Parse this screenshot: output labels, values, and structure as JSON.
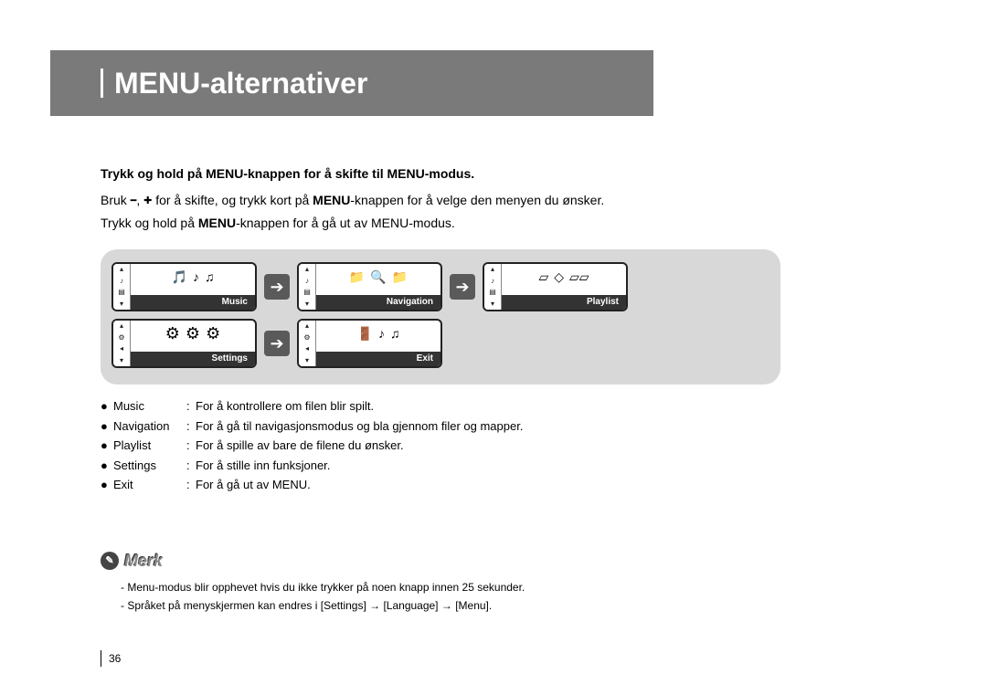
{
  "header": {
    "title": "MENU-alternativer"
  },
  "instructions": {
    "line1": "Trykk og hold på  MENU-knappen for å skifte til MENU-modus.",
    "line2_pre": "Bruk ",
    "line2_post": " for å skifte, og trykk kort på ",
    "line2_b": "MENU",
    "line2_end": "-knappen for å velge den menyen du ønsker.",
    "line3_pre": "Trykk og hold på ",
    "line3_b": "MENU",
    "line3_post": "-knappen for å gå ut av MENU-modus."
  },
  "screens": {
    "music": "Music",
    "navigation": "Navigation",
    "playlist": "Playlist",
    "settings": "Settings",
    "exit": "Exit"
  },
  "descriptions": [
    {
      "term": "Music",
      "text": "For å kontrollere om filen blir spilt."
    },
    {
      "term": "Navigation",
      "text": "For å gå til navigasjonsmodus og bla gjennom filer og mapper."
    },
    {
      "term": "Playlist",
      "text": "For å spille av bare de filene du ønsker."
    },
    {
      "term": "Settings",
      "text": "For å stille inn funksjoner."
    },
    {
      "term": "Exit",
      "text": "For å gå ut av MENU."
    }
  ],
  "merk": {
    "heading": "Merk",
    "note1": "- Menu-modus blir opphevet hvis du ikke trykker på noen knapp innen 25 sekunder.",
    "note2": "- Språket på menyskjermen kan endres i [Settings] → [Language] → [Menu]."
  },
  "page_number": "36"
}
